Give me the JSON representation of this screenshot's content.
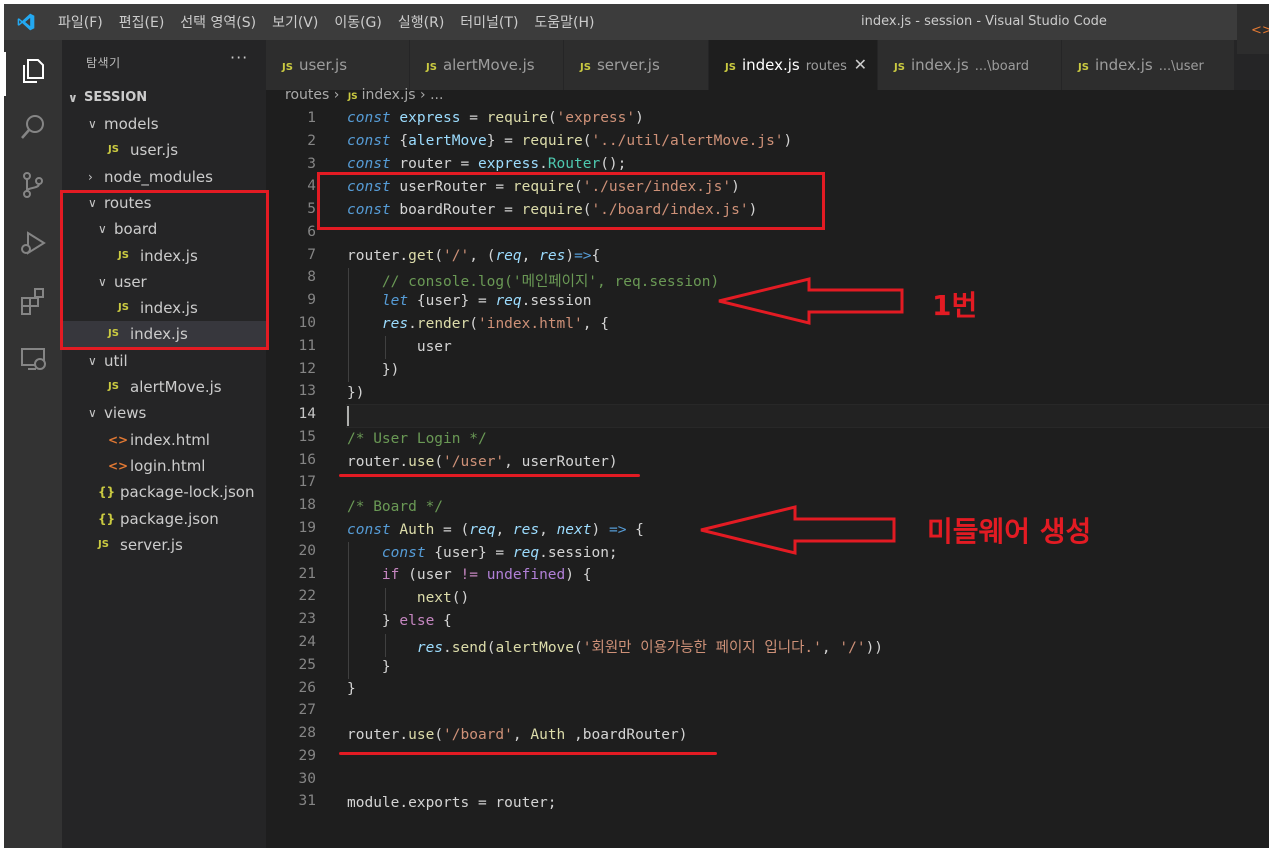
{
  "window": {
    "title": "index.js - session - Visual Studio Code",
    "menu": [
      "파일(F)",
      "편집(E)",
      "선택 영역(S)",
      "보기(V)",
      "이동(G)",
      "실행(R)",
      "터미널(T)",
      "도움말(H)"
    ]
  },
  "activity_bar": [
    "explorer-icon",
    "search-icon",
    "source-control-icon",
    "run-debug-icon",
    "extensions-icon",
    "remote-explorer-icon"
  ],
  "sidebar": {
    "title": "탐색기",
    "more": "···",
    "section": "SESSION",
    "tree": [
      {
        "label": "models",
        "type": "folder",
        "depth": 1,
        "open": true
      },
      {
        "label": "user.js",
        "type": "js",
        "depth": 2
      },
      {
        "label": "node_modules",
        "type": "folder",
        "depth": 1,
        "open": false
      },
      {
        "label": "routes",
        "type": "folder",
        "depth": 1,
        "open": true
      },
      {
        "label": "board",
        "type": "folder",
        "depth": 2,
        "open": true
      },
      {
        "label": "index.js",
        "type": "js",
        "depth": 3
      },
      {
        "label": "user",
        "type": "folder",
        "depth": 2,
        "open": true
      },
      {
        "label": "index.js",
        "type": "js",
        "depth": 3
      },
      {
        "label": "index.js",
        "type": "js",
        "depth": 2,
        "selected": true
      },
      {
        "label": "util",
        "type": "folder",
        "depth": 1,
        "open": true
      },
      {
        "label": "alertMove.js",
        "type": "js",
        "depth": 2
      },
      {
        "label": "views",
        "type": "folder",
        "depth": 1,
        "open": true
      },
      {
        "label": "index.html",
        "type": "html",
        "depth": 2
      },
      {
        "label": "login.html",
        "type": "html",
        "depth": 2
      },
      {
        "label": "package-lock.json",
        "type": "json",
        "depth": 1
      },
      {
        "label": "package.json",
        "type": "json",
        "depth": 1
      },
      {
        "label": "server.js",
        "type": "js",
        "depth": 1
      }
    ]
  },
  "tabs": [
    {
      "label": "user.js",
      "desc": "",
      "active": false
    },
    {
      "label": "alertMove.js",
      "desc": "",
      "active": false
    },
    {
      "label": "server.js",
      "desc": "",
      "active": false
    },
    {
      "label": "index.js",
      "desc": "routes",
      "active": true
    },
    {
      "label": "index.js",
      "desc": "...\\board",
      "active": false
    },
    {
      "label": "index.js",
      "desc": "...\\user",
      "active": false
    }
  ],
  "breadcrumb": {
    "folder": "routes",
    "file": "index.js",
    "rest": "..."
  },
  "editor": {
    "current_line": 14,
    "line_numbers": [
      "1",
      "2",
      "3",
      "4",
      "5",
      "6",
      "7",
      "8",
      "9",
      "10",
      "11",
      "12",
      "13",
      "14",
      "15",
      "16",
      "17",
      "18",
      "19",
      "20",
      "21",
      "22",
      "23",
      "24",
      "25",
      "26",
      "27",
      "28",
      "29",
      "30",
      "31"
    ]
  },
  "annotations": {
    "label_1": "1번",
    "label_2": "미들웨어 생성"
  },
  "colors": {
    "annotation": "#e31b23",
    "accent": "#007acc"
  }
}
